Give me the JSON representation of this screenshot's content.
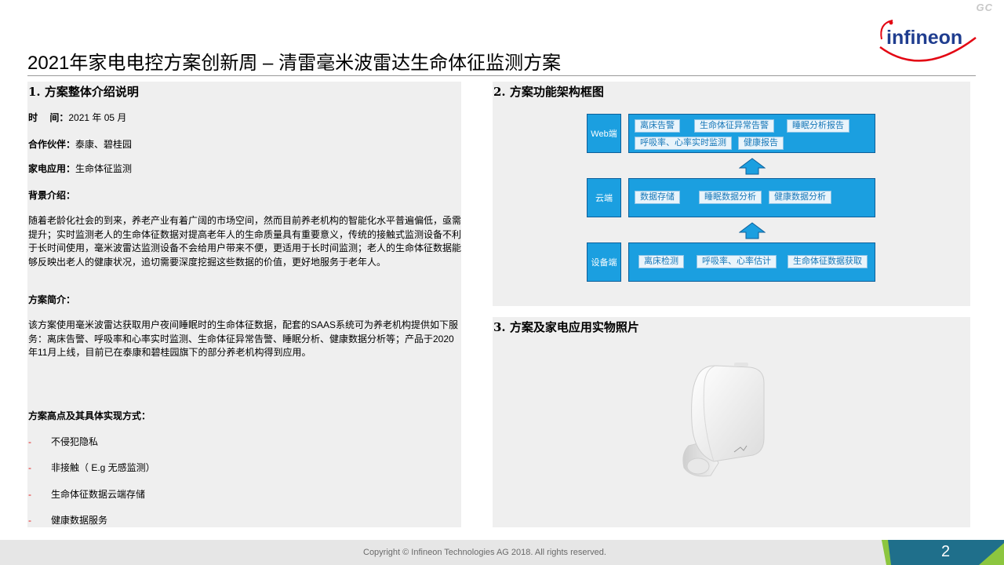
{
  "corner_tag": "GC",
  "logo": {
    "text": "infineon",
    "accent": "#e30613",
    "brand": "#1f3d8f"
  },
  "title": "2021年家电电控方案创新周 – 清雷毫米波雷达生命体征监测方案",
  "left": {
    "heading": "1. 方案整体介绍说明",
    "time_label": "时　 间：",
    "time_value": "2021 年 05 月",
    "partner_label": "合作伙伴：",
    "partner_value": "泰康、碧桂园",
    "appliance_label": "家电应用：",
    "appliance_value": "生命体征监测",
    "bg_label": "背景介绍：",
    "bg_text": "随着老龄化社会的到来，养老产业有着广阔的市场空间，然而目前养老机构的智能化水平普遍偏低，亟需提升；实时监测老人的生命体征数据对提高老年人的生命质量具有重要意义，传统的接触式监测设备不利于长时间使用，毫米波雷达监测设备不会给用户带来不便，更适用于长时间监测；老人的生命体征数据能够反映出老人的健康状况，追切需要深度挖掘这些数据的价值，更好地服务于老年人。",
    "intro_label": "方案简介：",
    "intro_text": "该方案使用毫米波雷达获取用户夜间睡眠时的生命体征数据，配套的SAAS系统可为养老机构提供如下服务：离床告警、呼吸率和心率实时监测、生命体征异常告警、睡眠分析、健康数据分析等；产品于2020年11月上线，目前已在泰康和碧桂园旗下的部分养老机构得到应用。",
    "highlights_label": "方案高点及其具体实现方式：",
    "highlights": [
      "不侵犯隐私",
      "非接触（ E.g 无感监测）",
      "生命体征数据云端存储",
      "健康数据服务"
    ]
  },
  "diagram": {
    "heading": "2. 方案功能架构框图",
    "tiers": [
      {
        "label": "Web端",
        "rows": [
          [
            "离床告警",
            "生命体征异常告警",
            "睡眠分析报告"
          ],
          [
            "呼吸率、心率实时监测",
            "健康报告"
          ]
        ]
      },
      {
        "label": "云端",
        "rows": [
          [
            "数据存储",
            "睡眠数据分析",
            "健康数据分析"
          ]
        ]
      },
      {
        "label": "设备端",
        "rows": [
          [
            "离床检测",
            "呼吸率、心率估计",
            "生命体征数据获取"
          ]
        ]
      }
    ]
  },
  "photo": {
    "heading": "3. 方案及家电应用实物照片"
  },
  "footer": {
    "copyright": "Copyright © Infineon Technologies AG 2018. All rights reserved.",
    "page": "2",
    "accent": "#8cc63f"
  }
}
